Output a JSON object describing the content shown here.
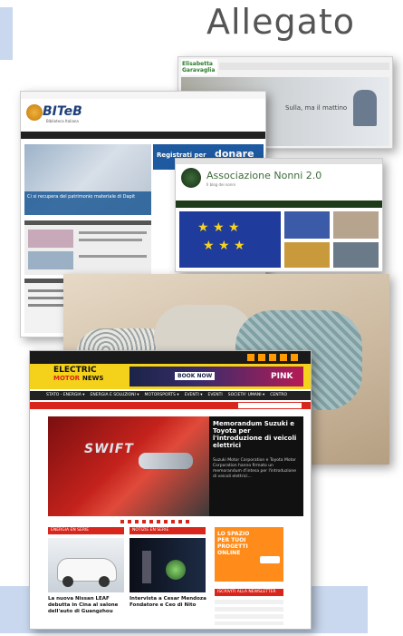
{
  "header": {
    "title": "Allegato"
  },
  "site1": {
    "logo_text": "Elisabetta Garavaglia",
    "hero_caption": "Sulla, ma il mattino"
  },
  "site2": {
    "logo_text": "BITeB",
    "logo_sub": "Biblioteca Italiana",
    "register_label": "Registrati per",
    "donate_label": "donare",
    "article_title": "Ci si recupera del patrimonio materiale di Dapit"
  },
  "site3": {
    "title": "Associazione Nonni 2.0",
    "subtitle": "Il blog dei nonni"
  },
  "site4": {
    "logo_line1": "ELECTRIC",
    "logo_line2": "MOTOR",
    "logo_line3": "NEWS",
    "banner_button": "BOOK NOW",
    "banner_text": "PINK",
    "nav": [
      "STATO - ENERGIA ▾",
      "ENERGIA E SOLUZIONI ▾",
      "MOTORSPORTS ▾",
      "EVENTI ▾",
      "EVENTI",
      "SOCIETA' UMANI ▾",
      "CENTRO"
    ],
    "hero_title": "Memorandum Suzuki e Toyota per l'introduzione di veicoli elettrici",
    "hero_body": "Suzuki Motor Corporation e Toyota Motor Corporation hanno firmato un memorandum d'intesa per l'introduzione di veicoli elettrici...",
    "car_badge": "SWIFT",
    "col1_header": "ENERGIA EN SERIE",
    "col2_header": "NOTIZIE EN SERIE",
    "col1_caption": "La nuova Nissan LEAF debutta in Cina al salone dell'auto di Guangzhou",
    "col2_caption": "Intervista a Cesar Mendoza Fondatore e Ceo di Nito",
    "ad_text": "LO SPAZIO PER TUOI PROGETTI ONLINE",
    "sidebar_header": "ISCRIVITI ALLA NEWSLETTER"
  }
}
